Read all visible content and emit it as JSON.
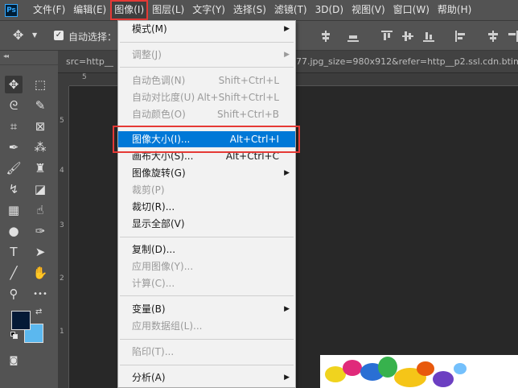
{
  "app": {
    "logo": "Ps"
  },
  "menubar": {
    "items": [
      "文件(F)",
      "编辑(E)",
      "图像(I)",
      "图层(L)",
      "文字(Y)",
      "选择(S)",
      "滤镜(T)",
      "3D(D)",
      "视图(V)",
      "窗口(W)",
      "帮助(H)"
    ],
    "active_index": 2
  },
  "options": {
    "auto_select_label": "自动选择：",
    "auto_select_checked": true
  },
  "document": {
    "tab_prefix": "src=http__",
    "tab_suffix": "77.jpg_size=980x912&refer=http__p2.ssl.cdn.btime"
  },
  "rulers": {
    "top_labels": [
      "5"
    ],
    "left_labels": [
      "5",
      "4",
      "3",
      "2",
      "1"
    ]
  },
  "colors": {
    "foreground": "#051a36",
    "background": "#5bb8ef",
    "highlight": "#0078d7",
    "annotation": "#e53935"
  },
  "image_menu": {
    "items": [
      {
        "label": "模式(M)",
        "shortcut": "",
        "submenu": true,
        "disabled": false
      },
      {
        "label": "调整(J)",
        "shortcut": "",
        "submenu": true,
        "disabled": true
      },
      {
        "label": "自动色调(N)",
        "shortcut": "Shift+Ctrl+L",
        "submenu": false,
        "disabled": true
      },
      {
        "label": "自动对比度(U)",
        "shortcut": "Alt+Shift+Ctrl+L",
        "submenu": false,
        "disabled": true
      },
      {
        "label": "自动颜色(O)",
        "shortcut": "Shift+Ctrl+B",
        "submenu": false,
        "disabled": true
      },
      {
        "label": "图像大小(I)...",
        "shortcut": "Alt+Ctrl+I",
        "submenu": false,
        "disabled": false,
        "highlighted": true
      },
      {
        "label": "画布大小(S)...",
        "shortcut": "Alt+Ctrl+C",
        "submenu": false,
        "disabled": false
      },
      {
        "label": "图像旋转(G)",
        "shortcut": "",
        "submenu": true,
        "disabled": false
      },
      {
        "label": "裁剪(P)",
        "shortcut": "",
        "submenu": false,
        "disabled": true
      },
      {
        "label": "裁切(R)...",
        "shortcut": "",
        "submenu": false,
        "disabled": false
      },
      {
        "label": "显示全部(V)",
        "shortcut": "",
        "submenu": false,
        "disabled": false
      },
      {
        "label": "复制(D)...",
        "shortcut": "",
        "submenu": false,
        "disabled": false
      },
      {
        "label": "应用图像(Y)...",
        "shortcut": "",
        "submenu": false,
        "disabled": true
      },
      {
        "label": "计算(C)...",
        "shortcut": "",
        "submenu": false,
        "disabled": true
      },
      {
        "label": "变量(B)",
        "shortcut": "",
        "submenu": true,
        "disabled": false
      },
      {
        "label": "应用数据组(L)...",
        "shortcut": "",
        "submenu": false,
        "disabled": true
      },
      {
        "label": "陷印(T)...",
        "shortcut": "",
        "submenu": false,
        "disabled": true
      },
      {
        "label": "分析(A)",
        "shortcut": "",
        "submenu": true,
        "disabled": false
      }
    ]
  },
  "tools": [
    "move-tool",
    "marquee-tool",
    "lasso-tool",
    "quick-select-tool",
    "crop-tool",
    "frame-tool",
    "eyedropper-tool",
    "patch-tool",
    "brush-tool",
    "stamp-tool",
    "history-brush-tool",
    "eraser-tool",
    "gradient-tool",
    "smudge-tool",
    "dodge-tool",
    "pen-tool",
    "type-tool",
    "path-select-tool",
    "line-tool",
    "hand-tool",
    "zoom-tool",
    "more-tools"
  ]
}
